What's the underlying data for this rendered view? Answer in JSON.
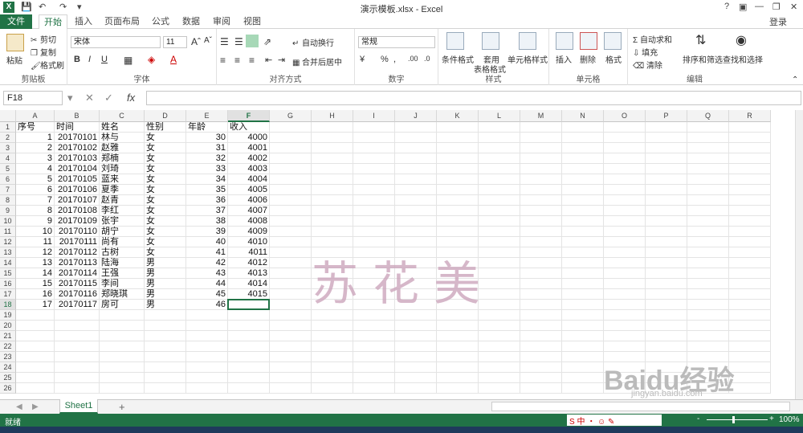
{
  "window": {
    "title": "演示模板.xlsx - Excel",
    "app_icon": "X",
    "help": "?",
    "login": "登录"
  },
  "tabs": [
    {
      "label": "文件"
    },
    {
      "label": "开始"
    },
    {
      "label": "插入"
    },
    {
      "label": "页面布局"
    },
    {
      "label": "公式"
    },
    {
      "label": "数据"
    },
    {
      "label": "审阅"
    },
    {
      "label": "视图"
    }
  ],
  "ribbon": {
    "clipboard": {
      "group": "剪贴板",
      "paste": "粘贴",
      "cut": "剪切",
      "copy": "复制",
      "format_painter": "格式刷"
    },
    "font": {
      "group": "字体",
      "font_name": "宋体",
      "font_size": "11",
      "bold": "B",
      "italic": "I",
      "underline": "U"
    },
    "alignment": {
      "group": "对齐方式",
      "wrap": "自动换行",
      "merge": "合并后居中"
    },
    "number": {
      "group": "数字",
      "format": "常规",
      "percent": "%"
    },
    "styles": {
      "group": "样式",
      "conditional": "条件格式",
      "table_l1": "套用",
      "table_l2": "表格格式",
      "cell_styles": "单元格样式"
    },
    "cells": {
      "group": "单元格",
      "insert": "插入",
      "delete": "删除",
      "format": "格式"
    },
    "editing": {
      "group": "编辑",
      "autosum": "自动求和",
      "fill": "填充",
      "clear": "清除",
      "sort": "排序和筛选",
      "find": "查找和选择"
    }
  },
  "formula_bar": {
    "name_box": "F18",
    "fx": "fx",
    "value": ""
  },
  "columns": [
    "A",
    "B",
    "C",
    "D",
    "E",
    "F",
    "G",
    "H",
    "I",
    "J",
    "K",
    "L",
    "M",
    "N",
    "O",
    "P",
    "Q",
    "R"
  ],
  "selected_col": "F",
  "selected_row": 18,
  "row_numbers": [
    1,
    2,
    3,
    4,
    5,
    6,
    7,
    8,
    9,
    10,
    11,
    12,
    13,
    14,
    15,
    16,
    17,
    18,
    19,
    20,
    21,
    22,
    23,
    24,
    25,
    26
  ],
  "headers": [
    "序号",
    "时间",
    "姓名",
    "性别",
    "年龄",
    "收入"
  ],
  "rows": [
    [
      "1",
      "20170101",
      "林与",
      "女",
      "30",
      "4000"
    ],
    [
      "2",
      "20170102",
      "赵雅",
      "女",
      "31",
      "4001"
    ],
    [
      "3",
      "20170103",
      "郑楠",
      "女",
      "32",
      "4002"
    ],
    [
      "4",
      "20170104",
      "刘琦",
      "女",
      "33",
      "4003"
    ],
    [
      "5",
      "20170105",
      "蓝来",
      "女",
      "34",
      "4004"
    ],
    [
      "6",
      "20170106",
      "夏季",
      "女",
      "35",
      "4005"
    ],
    [
      "7",
      "20170107",
      "赵青",
      "女",
      "36",
      "4006"
    ],
    [
      "8",
      "20170108",
      "李红",
      "女",
      "37",
      "4007"
    ],
    [
      "9",
      "20170109",
      "张宇",
      "女",
      "38",
      "4008"
    ],
    [
      "10",
      "20170110",
      "胡宁",
      "女",
      "39",
      "4009"
    ],
    [
      "11",
      "20170111",
      "尚有",
      "女",
      "40",
      "4010"
    ],
    [
      "12",
      "20170112",
      "古树",
      "女",
      "41",
      "4011"
    ],
    [
      "13",
      "20170113",
      "陆海",
      "男",
      "42",
      "4012"
    ],
    [
      "14",
      "20170114",
      "王强",
      "男",
      "43",
      "4013"
    ],
    [
      "15",
      "20170115",
      "李间",
      "男",
      "44",
      "4014"
    ],
    [
      "16",
      "20170116",
      "郑晓琪",
      "男",
      "45",
      "4015"
    ],
    [
      "17",
      "20170117",
      "房可",
      "男",
      "46",
      ""
    ]
  ],
  "sheet": {
    "name": "Sheet1",
    "add": "+"
  },
  "status": {
    "ready": "就绪",
    "zoom": "100%",
    "minus": "-",
    "plus": "+"
  },
  "watermark": {
    "text": "苏花美",
    "site": "Baidu经验",
    "url": "jingyan.baidu.com"
  }
}
